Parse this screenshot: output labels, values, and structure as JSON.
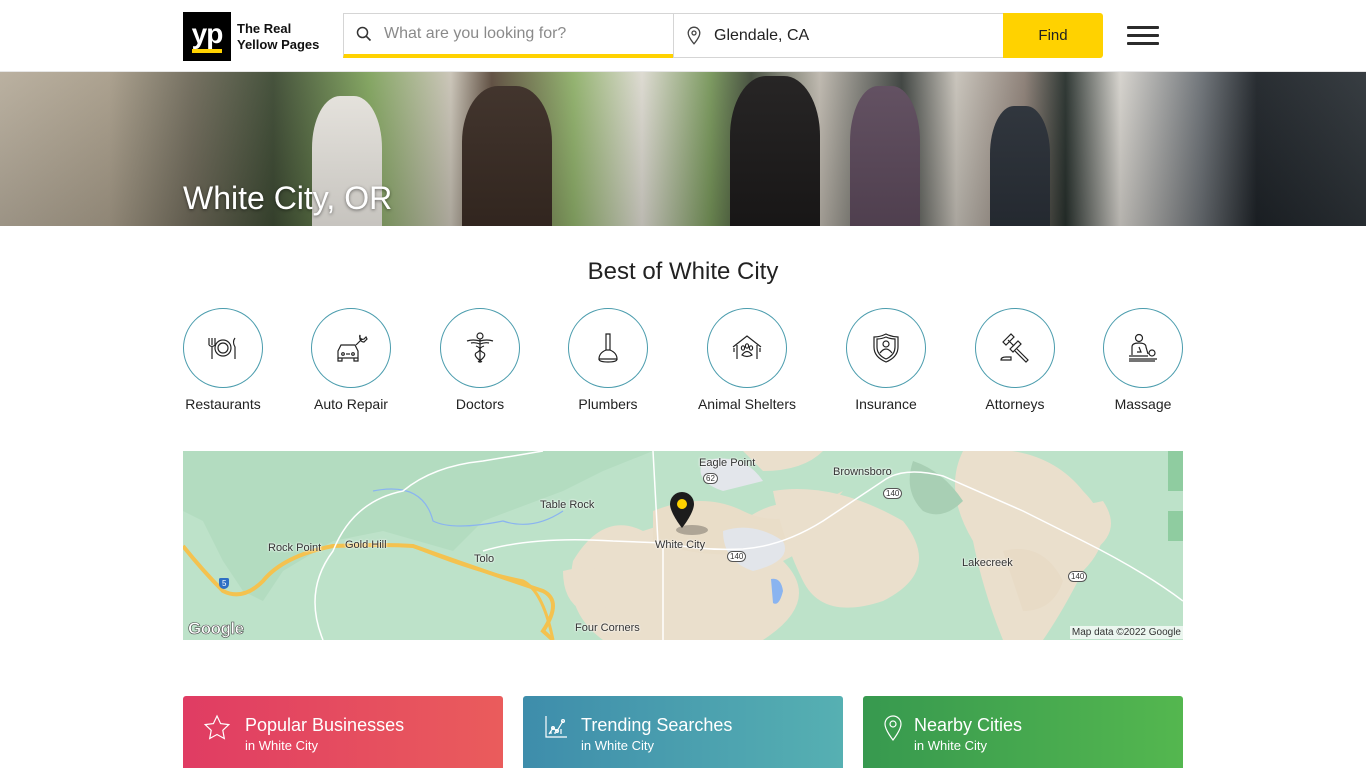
{
  "header": {
    "logo_mark": "yp",
    "logo_text_line1": "The Real",
    "logo_text_line2": "Yellow Pages",
    "search_placeholder": "What are you looking for?",
    "search_value": "",
    "location_value": "Glendale, CA",
    "find_label": "Find",
    "accent_color": "#ffd200"
  },
  "hero": {
    "title": "White City, OR"
  },
  "best": {
    "title": "Best of White City",
    "categories": [
      {
        "label": "Restaurants",
        "icon": "restaurant-icon"
      },
      {
        "label": "Auto Repair",
        "icon": "auto-repair-icon"
      },
      {
        "label": "Doctors",
        "icon": "caduceus-icon"
      },
      {
        "label": "Plumbers",
        "icon": "plunger-icon"
      },
      {
        "label": "Animal Shelters",
        "icon": "animal-shelter-icon"
      },
      {
        "label": "Insurance",
        "icon": "shield-person-icon"
      },
      {
        "label": "Attorneys",
        "icon": "gavel-icon"
      },
      {
        "label": "Massage",
        "icon": "massage-icon"
      }
    ]
  },
  "map": {
    "places": [
      "Eagle Point",
      "Brownsboro",
      "Table Rock",
      "White City",
      "Rock Point",
      "Gold Hill",
      "Tolo",
      "Lakecreek",
      "Four Corners"
    ],
    "shields": [
      "62",
      "140",
      "140",
      "140",
      "5"
    ],
    "google_logo": "Google",
    "attribution": "Map data ©2022 Google"
  },
  "cards": [
    {
      "title": "Popular Businesses",
      "subtitle": "in White City",
      "icon": "star-icon",
      "color_from": "#e03c63",
      "color_to": "#ea5c5c"
    },
    {
      "title": "Trending Searches",
      "subtitle": "in White City",
      "icon": "trending-chart-icon",
      "color_from": "#3e8dab",
      "color_to": "#56b0b2"
    },
    {
      "title": "Nearby Cities",
      "subtitle": "in White City",
      "icon": "location-pin-icon",
      "color_from": "#37994f",
      "color_to": "#54b74f"
    }
  ]
}
